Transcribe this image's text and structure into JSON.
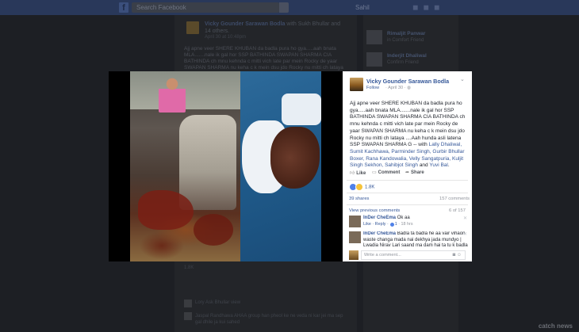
{
  "background": {
    "search_placeholder": "Search Facebook",
    "top_user": "Sahil",
    "bg_author": "Vicky Gounder Sarawan Bodla",
    "bg_author_with": "with Sukh Bhullar and 14 others.",
    "bg_date": "April 30 at 10:48pm",
    "bg_text": "Ajj apne veer SHERE KHUBAN da badla pura ho gya.....aah bnata MLA.......nale ik gal hor SSP BATHINDA SWAPAN SHARMA CIA BATHINDA ch mnu kehnda c mitti vich late par mein Rocky de yaar SWAPAN SHARMA nu keha c k mein dsu jdo Rocky nu mitti ch lataya ....Aah hunda asli latena SSP",
    "side_items": [
      {
        "name": "Rimaljit Panwar",
        "sub": "in Comfort Friend"
      },
      {
        "name": "Inderjit Dhaliwal",
        "sub": "Confirm Friend"
      }
    ],
    "lower_text": "1.8K",
    "lower_rows": [
      "Lory Ask Bhullar view",
      "Jaspal Randhawa AHAA group han pheol ke ne veda ni kar jei ma sep gal dhile ja kui sahed"
    ],
    "watermark": "catch news"
  },
  "post": {
    "author": "Vicky Gounder Sarawan Bodla",
    "follow": "Follow",
    "date": "April 30",
    "text_plain": "Ajj apne veer SHERE KHUBAN da badla pura ho gya.....aah bnata MLA.......nale ik gal hor SSP BATHINDA SWAPAN SHARMA CIA BATHINDA ch mnu kehnda c mitti vich late par mein Rocky de yaar SWAPAN SHARMA nu keha c k mein dsu jdo Rocky nu mitti ch lataya ....Aah hunda asli latena SSP SWAPAN SHARMA G -- ",
    "tags_prefix": "with ",
    "tags": "Lally Dhaliwal, Sumit Kachhawa, Parminder Singh, Gurbir Bhullar Boxer, Rana Kandowalia, Velly Sangatpuria, Kuljit Singh Sekhon, Sahibjot Singh",
    "tags_and": " and ",
    "tags_last": "Yuvi Bal",
    "tags_end": "."
  },
  "actions": {
    "like": "Like",
    "comment": "Comment",
    "share": "Share"
  },
  "stats": {
    "reactions": "1.8K",
    "shares": "39 shares",
    "comments": "157 comments",
    "view_previous": "View previous comments",
    "position": "6 of 157"
  },
  "comments": [
    {
      "name": "InDer CheEma",
      "text": "Ok aa",
      "meta_reply": "Like · Reply · ",
      "meta_likes": "1",
      "meta_time": " · 18 hrs"
    },
    {
      "name": "InDer CheEma",
      "text": "Badla ta badla he aa vair vihaon waste changa mada nai dekhya jada mundyo | Lwadia Nirav Lari saand ma dam hai ta tu k badla"
    }
  ],
  "composer": {
    "placeholder": "Write a comment..."
  },
  "colors": {
    "link": "#365899",
    "text": "#1d2129",
    "meta": "#90949c",
    "dim_background": "#1d1f24",
    "topbar": "#29385a"
  },
  "icons": [
    "facebook-logo-icon",
    "search-icon",
    "chevron-down-icon",
    "like-icon",
    "comment-icon",
    "share-icon",
    "reaction-like-icon",
    "reaction-wow-icon",
    "camera-icon",
    "sticker-icon"
  ]
}
